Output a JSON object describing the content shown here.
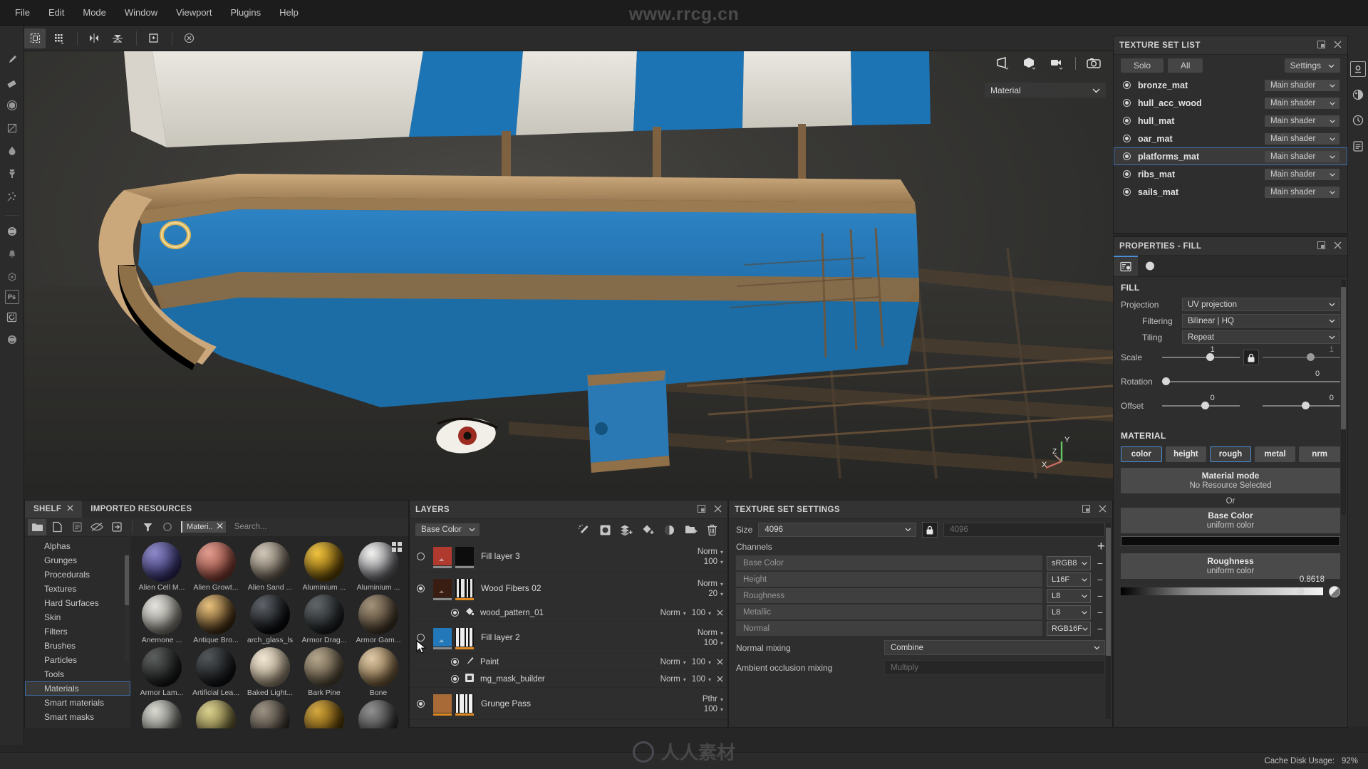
{
  "menu": {
    "items": [
      "File",
      "Edit",
      "Mode",
      "Window",
      "Viewport",
      "Plugins",
      "Help"
    ]
  },
  "watermarks": {
    "top": "www.rrcg.cn",
    "bottom": "人人素材"
  },
  "toolbar": {
    "icons": [
      "uv-tile-icon",
      "grid-icon",
      "symmetry-icon",
      "symmetry-plane-icon",
      "bake-icon",
      "reset-icon"
    ]
  },
  "left_rail": {
    "icons": [
      "paint-brush-icon",
      "eraser-icon",
      "projection-icon",
      "polygon-fill-icon",
      "smudge-icon",
      "clone-stamp-icon",
      "particles-icon",
      "substance-icon",
      "alert-icon",
      "hex-icon",
      "photoshop-icon",
      "refresh-icon",
      "substance-logo-icon"
    ]
  },
  "viewport": {
    "top_icons": [
      "perspective-icon",
      "cube-icon",
      "camera-icon",
      "screenshot-icon"
    ],
    "material_dropdown": "Material",
    "gizmo": {
      "x": "X",
      "y": "Y",
      "z": "Z"
    }
  },
  "texture_set_list": {
    "title": "TEXTURE SET LIST",
    "solo_label": "Solo",
    "all_label": "All",
    "settings_label": "Settings",
    "selected": "platforms_mat",
    "rows": [
      {
        "name": "bronze_mat",
        "shader": "Main shader"
      },
      {
        "name": "hull_acc_wood",
        "shader": "Main shader"
      },
      {
        "name": "hull_mat",
        "shader": "Main shader"
      },
      {
        "name": "oar_mat",
        "shader": "Main shader"
      },
      {
        "name": "platforms_mat",
        "shader": "Main shader"
      },
      {
        "name": "ribs_mat",
        "shader": "Main shader"
      },
      {
        "name": "sails_mat",
        "shader": "Main shader"
      }
    ]
  },
  "properties": {
    "title": "PROPERTIES - FILL",
    "tabs": [
      "properties-tab-icon",
      "material-tab-icon"
    ],
    "fill_heading": "FILL",
    "fields": [
      {
        "label": "Projection",
        "value": "UV projection"
      },
      {
        "label": "Filtering",
        "value": "Bilinear | HQ"
      },
      {
        "label": "Tiling",
        "value": "Repeat"
      }
    ],
    "scale": {
      "label": "Scale",
      "value_left": "1",
      "value_right": "1"
    },
    "rotation": {
      "label": "Rotation",
      "value": "0"
    },
    "offset": {
      "label": "Offset",
      "value_left": "0",
      "value_right": "0"
    },
    "material_heading": "MATERIAL",
    "material_tabs": [
      {
        "label": "color",
        "on": true
      },
      {
        "label": "height",
        "on": false
      },
      {
        "label": "rough",
        "on": true
      },
      {
        "label": "metal",
        "on": false
      },
      {
        "label": "nrm",
        "on": false
      }
    ],
    "material_mode": {
      "title": "Material mode",
      "subtitle": "No Resource Selected"
    },
    "or_label": "Or",
    "base_color": {
      "title": "Base Color",
      "subtitle": "uniform color",
      "swatch": "#0b0b0b"
    },
    "roughness": {
      "title": "Roughness",
      "subtitle": "uniform color",
      "value": "0.8618"
    }
  },
  "right_rail": {
    "icons": [
      "display-settings-icon",
      "shader-settings-icon",
      "history-icon",
      "log-icon"
    ]
  },
  "shelf": {
    "tabs": [
      {
        "label": "SHELF",
        "active": true,
        "closable": true
      },
      {
        "label": "IMPORTED RESOURCES",
        "active": false,
        "closable": false
      }
    ],
    "tools": [
      "folder-icon",
      "new-file-icon",
      "list-icon",
      "hide-icon",
      "import-icon",
      "filter-icon",
      "circle-icon"
    ],
    "filter_chip": "Materi..",
    "search_placeholder": "Search...",
    "selected_category": "Materials",
    "categories": [
      "Alphas",
      "Grunges",
      "Procedurals",
      "Textures",
      "Hard Surfaces",
      "Skin",
      "Filters",
      "Brushes",
      "Particles",
      "Tools",
      "Materials",
      "Smart materials",
      "Smart masks"
    ],
    "items": [
      {
        "label": "Alien Cell M...",
        "c1": "#8a86c8",
        "c2": "#332f66"
      },
      {
        "label": "Alien Growt...",
        "c1": "#e09a8c",
        "c2": "#8c4338"
      },
      {
        "label": "Alien Sand ...",
        "c1": "#cfc6b6",
        "c2": "#6b6155"
      },
      {
        "label": "Aluminium ...",
        "c1": "#f0c13a",
        "c2": "#6b4f08"
      },
      {
        "label": "Aluminium ...",
        "c1": "#f2f2f0",
        "c2": "#6e6e74"
      },
      {
        "label": "Anemone ...",
        "c1": "#e4e2dc",
        "c2": "#8a8880"
      },
      {
        "label": "Antique Bro...",
        "c1": "#e8c07a",
        "c2": "#4a3418"
      },
      {
        "label": "arch_glass_ls",
        "c1": "#5a5f66",
        "c2": "#0a0b0d"
      },
      {
        "label": "Armor Drag...",
        "c1": "#5c6264",
        "c2": "#1b1f21"
      },
      {
        "label": "Armor Gam...",
        "c1": "#a08f76",
        "c2": "#46392a"
      },
      {
        "label": "Armor Lam...",
        "c1": "#565a58",
        "c2": "#18191a"
      },
      {
        "label": "Artificial Lea...",
        "c1": "#4c5154",
        "c2": "#121416"
      },
      {
        "label": "Baked Light...",
        "c1": "#f0e6d2",
        "c2": "#a2937c"
      },
      {
        "label": "Bark Pine",
        "c1": "#b2a389",
        "c2": "#5a4f3c"
      },
      {
        "label": "Bone",
        "c1": "#dec8a4",
        "c2": "#7c6340"
      },
      {
        "label": "",
        "c1": "#d8d8d0",
        "c2": "#6a6a66"
      },
      {
        "label": "",
        "c1": "#d8cf8a",
        "c2": "#6e6436"
      },
      {
        "label": "",
        "c1": "#9a8f80",
        "c2": "#3c3630"
      },
      {
        "label": "",
        "c1": "#d4a63a",
        "c2": "#5c4008"
      },
      {
        "label": "",
        "c1": "#8e8e8e",
        "c2": "#333333"
      }
    ]
  },
  "layers": {
    "title": "LAYERS",
    "channel_dropdown": "Base Color",
    "tools": [
      "magic-wand-icon",
      "add-effect-icon",
      "add-fill-layer-icon",
      "add-paint-layer-icon",
      "add-mask-icon",
      "add-folder-icon",
      "delete-icon"
    ],
    "rows": [
      {
        "type": "layer",
        "name": "Fill layer 3",
        "visible": false,
        "blend": "Norm",
        "opacity": "100",
        "thumb1": "#b03a2e",
        "thumb2": "#0d0d0d",
        "bar1": "#8a8a8a",
        "bar2": "#8a8a8a"
      },
      {
        "type": "layer",
        "name": "Wood Fibers 02",
        "visible": true,
        "blend": "Norm",
        "opacity": "20",
        "thumb1": "#3a1d12",
        "thumb2": "#d8d8d8",
        "bar1": "#8a8a8a",
        "bar2": "#e08a20"
      },
      {
        "type": "sub",
        "name": "wood_pattern_01",
        "visible": true,
        "blend": "Norm",
        "opacity": "100",
        "icon": "fill-icon"
      },
      {
        "type": "layer",
        "name": "Fill layer 2",
        "visible": false,
        "blend": "Norm",
        "opacity": "100",
        "thumb1": "#2278b8",
        "thumb2": "#d8d8d8",
        "bar1": "#8a8a8a",
        "bar2": "#e08a20"
      },
      {
        "type": "sub",
        "name": "Paint",
        "visible": true,
        "blend": "Norm",
        "opacity": "100",
        "icon": "brush-icon"
      },
      {
        "type": "sub",
        "name": "mg_mask_builder",
        "visible": true,
        "blend": "Norm",
        "opacity": "100",
        "icon": "mask-generator-icon"
      },
      {
        "type": "layer",
        "name": "Grunge Pass",
        "visible": true,
        "blend": "Pthr",
        "opacity": "100",
        "thumb1": "#a86b38",
        "thumb2": "#e2e2e2",
        "bar1": "#e08a20",
        "bar2": "#e08a20"
      }
    ]
  },
  "texture_set_settings": {
    "title": "TEXTURE SET SETTINGS",
    "size_label": "Size",
    "size_value": "4096",
    "size_value2": "4096",
    "channels_label": "Channels",
    "add_label": "+",
    "channels": [
      {
        "name": "Base Color",
        "format": "sRGB8"
      },
      {
        "name": "Height",
        "format": "L16F"
      },
      {
        "name": "Roughness",
        "format": "L8"
      },
      {
        "name": "Metallic",
        "format": "L8"
      },
      {
        "name": "Normal",
        "format": "RGB16F"
      }
    ],
    "normal_mixing": {
      "label": "Normal mixing",
      "value": "Combine"
    },
    "ao_mixing": {
      "label": "Ambient occlusion mixing",
      "value": "Multiply"
    }
  },
  "status": {
    "cache_label": "Cache Disk Usage:",
    "cache_value": "92%"
  }
}
